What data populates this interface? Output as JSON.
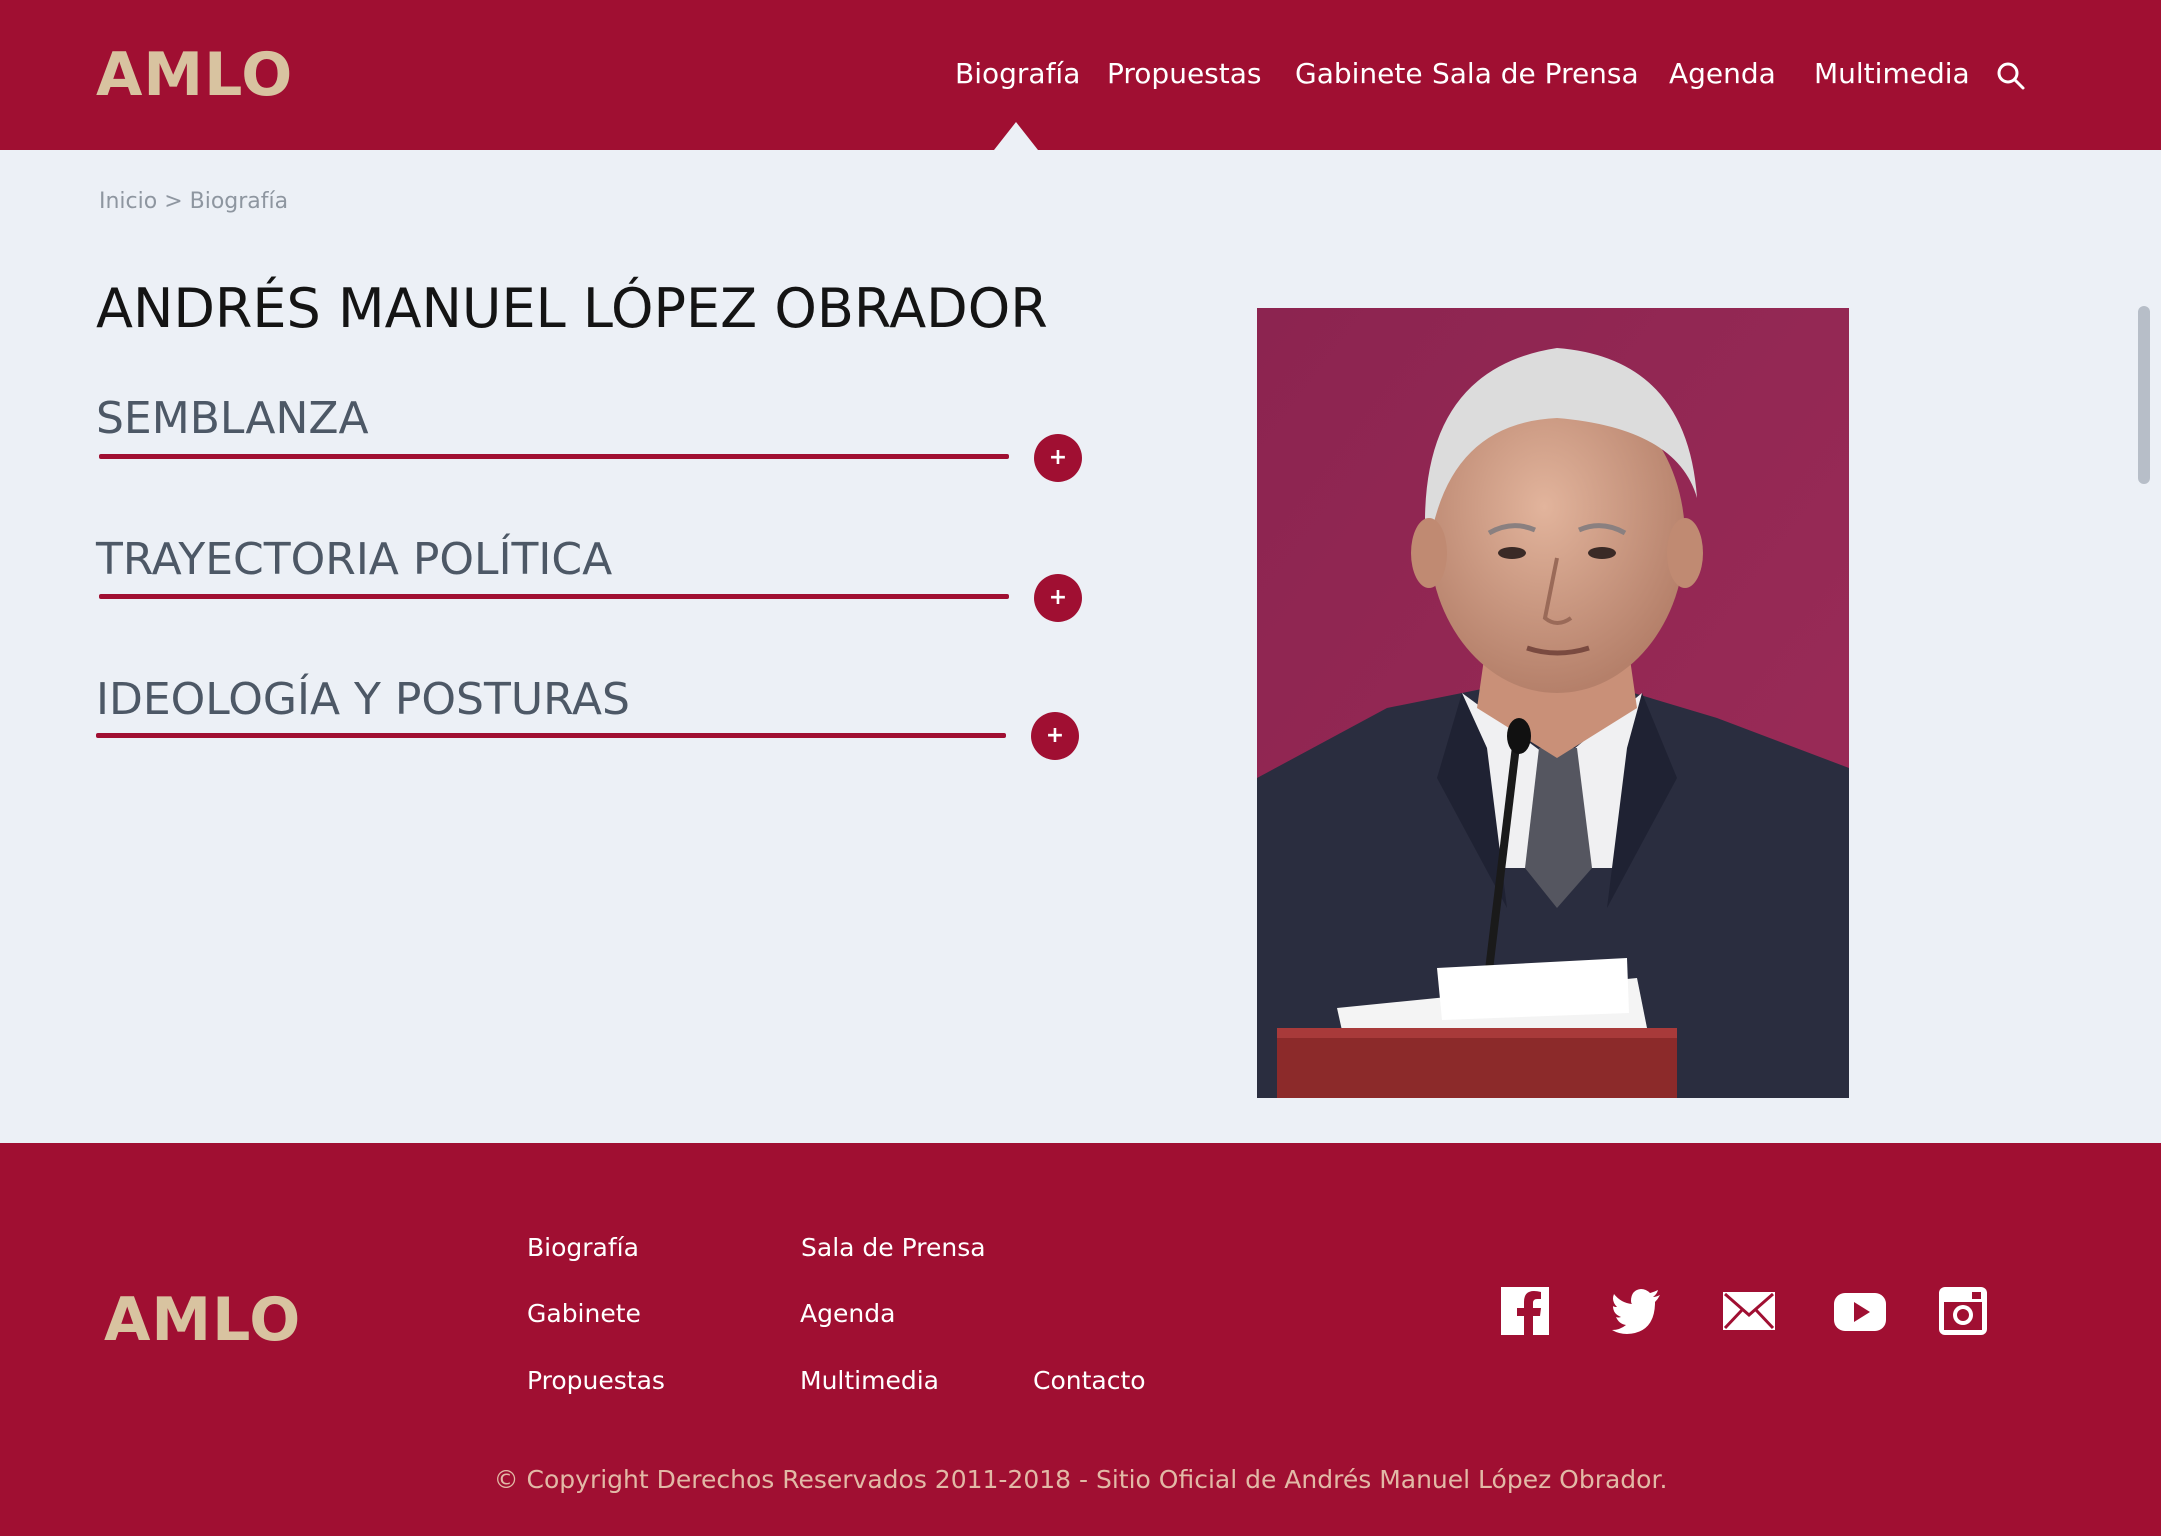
{
  "header": {
    "logo": "AMLO",
    "nav": {
      "biografia": "Biografía",
      "propuestas": "Propuestas",
      "gabinete": "Gabinete",
      "sala_de_prensa": "Sala de Prensa",
      "agenda": "Agenda",
      "multimedia": "Multimedia"
    },
    "active_nav": "Biografía",
    "search_icon": "search-icon"
  },
  "breadcrumb": "Inicio > Biografía",
  "main": {
    "title": "ANDRÉS MANUEL LÓPEZ OBRADOR",
    "sections": [
      {
        "label": "SEMBLANZA",
        "toggle": "+"
      },
      {
        "label": "TRAYECTORIA POLÍTICA",
        "toggle": "+"
      },
      {
        "label": "IDEOLOGÍA Y POSTURAS",
        "toggle": "+"
      }
    ],
    "photo_icon": "portrait-photo"
  },
  "footer": {
    "logo": "AMLO",
    "links": {
      "biografia": "Biografía",
      "sala_de_prensa": "Sala de Prensa",
      "gabinete": "Gabinete",
      "agenda": "Agenda",
      "propuestas": "Propuestas",
      "multimedia": "Multimedia",
      "contacto": "Contacto"
    },
    "social_icons": [
      "facebook-icon",
      "twitter-icon",
      "mail-icon",
      "youtube-icon",
      "instagram-icon"
    ],
    "copyright": "© Copyright Derechos Reservados 2011-2018 - Sitio Oficial de Andrés Manuel López Obrador."
  },
  "colors": {
    "brand_red": "#a00f32",
    "logo_gold": "#d8c3a0",
    "background": "#ecf0f6",
    "section_text": "#4d5866"
  }
}
